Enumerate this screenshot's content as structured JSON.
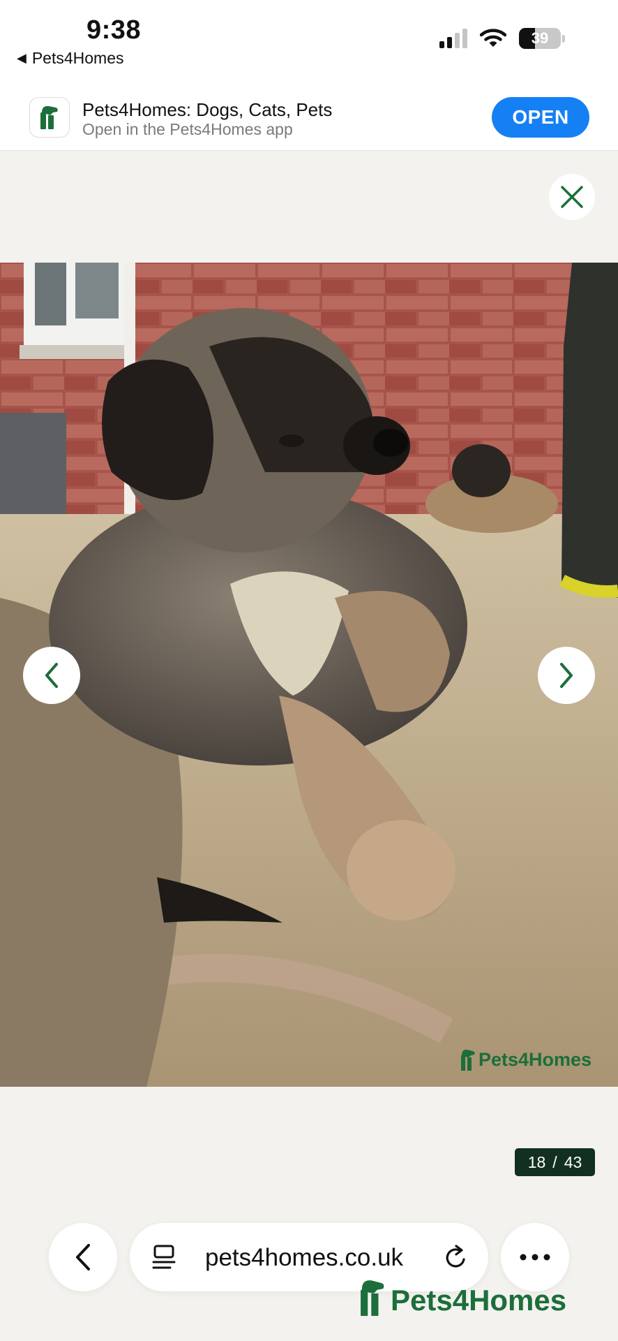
{
  "status_bar": {
    "time": "9:38",
    "back_app_label": "Pets4Homes",
    "battery_level": "39",
    "signal_bars_active": 2,
    "icons": [
      "back-triangle-icon",
      "cellular-signal-icon",
      "wifi-icon",
      "battery-icon"
    ]
  },
  "app_banner": {
    "app_name": "Pets4Homes: Dogs, Cats, Pets",
    "subtitle": "Open in the Pets4Homes app",
    "open_label": "OPEN",
    "icon": "pets4homes-app-icon"
  },
  "gallery": {
    "close_icon": "close-icon",
    "prev_icon": "chevron-left-icon",
    "next_icon": "chevron-right-icon",
    "watermark_text": "Pets4Homes",
    "current_index": "18",
    "separator": "/",
    "total": "43"
  },
  "toolbar": {
    "url": "pets4homes.co.uk",
    "back_icon": "chevron-left-icon",
    "reader_icon": "reader-mode-icon",
    "reload_icon": "reload-icon",
    "more_icon": "more-dots-icon"
  },
  "brand": {
    "logo_text": "Pets4Homes"
  },
  "colors": {
    "accent_blue": "#1580f3",
    "brand_green": "#1c6e3a",
    "counter_bg": "#12301f",
    "page_bg": "#f3f2ef"
  }
}
